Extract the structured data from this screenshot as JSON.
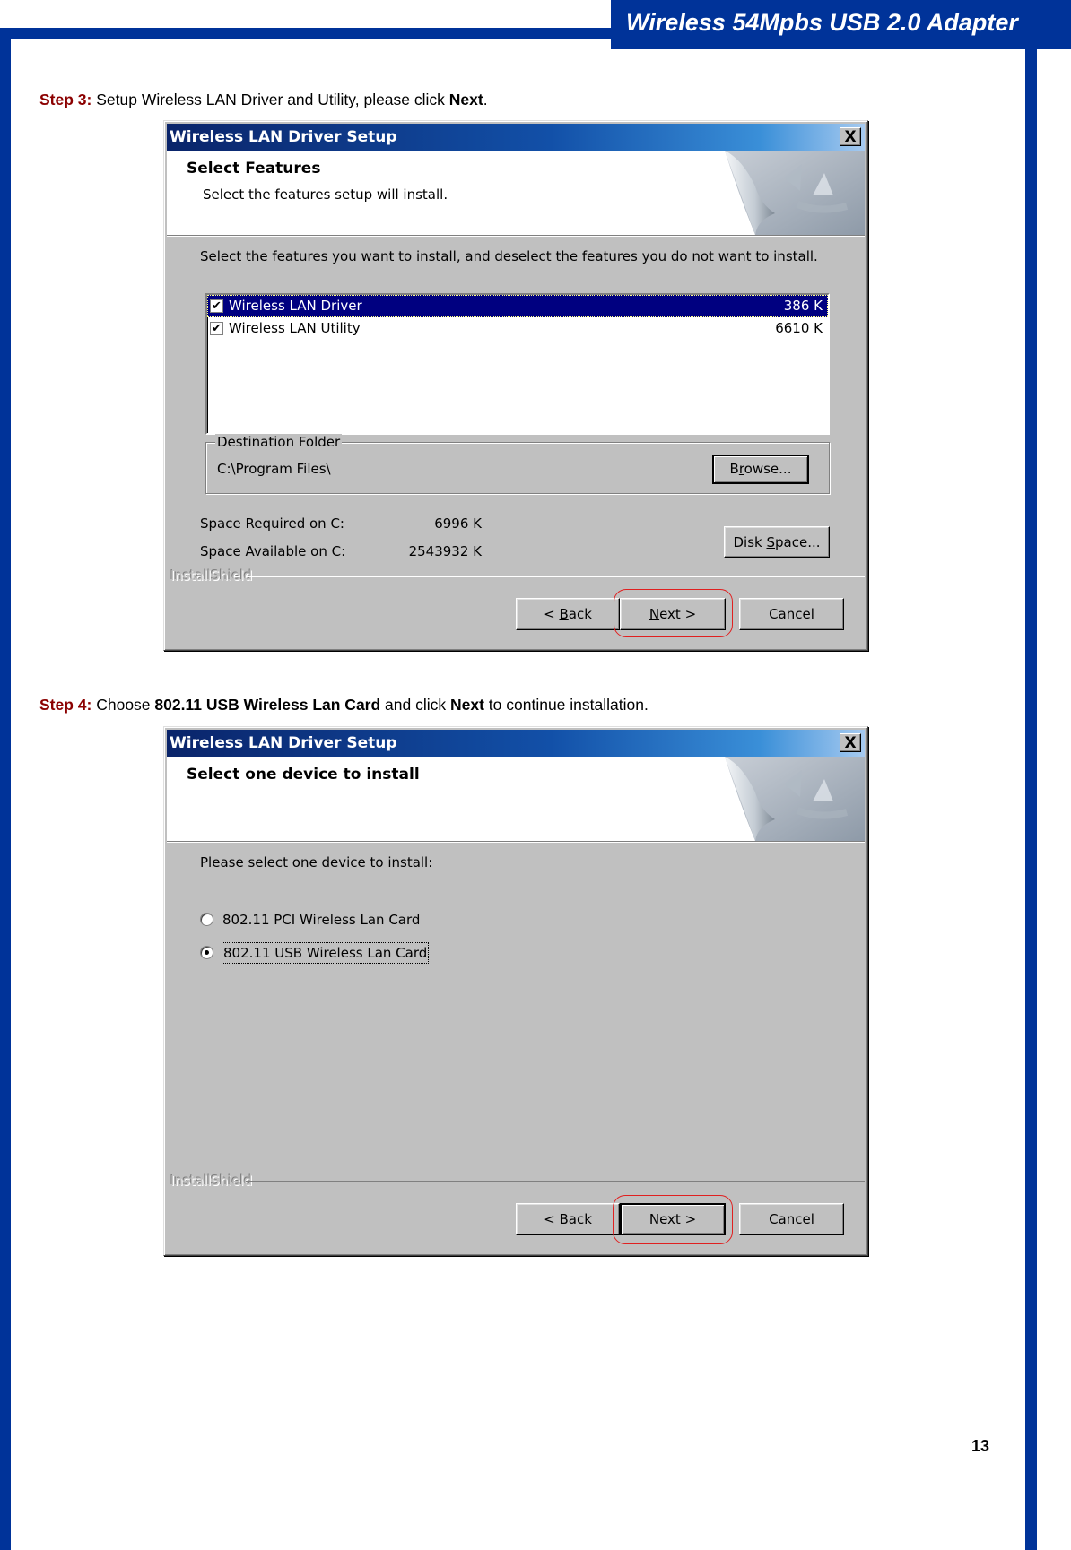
{
  "page": {
    "banner_title": "Wireless 54Mpbs USB 2.0 Adapter",
    "page_number": "13",
    "brand_color": "#003399",
    "step_label_color": "#8b0000"
  },
  "step3": {
    "label": "Step 3:",
    "text_before": " Setup Wireless LAN Driver and Utility, please click ",
    "bold": "Next",
    "text_after": "."
  },
  "step4": {
    "label": "Step 4:",
    "text_1": " Choose ",
    "bold_1": "802.11 USB Wireless Lan Card",
    "text_2": " and click ",
    "bold_2": "Next",
    "text_3": " to continue installation."
  },
  "dialog1": {
    "title": "Wireless LAN Driver Setup",
    "close_glyph": "X",
    "header_title": "Select Features",
    "header_subtitle": "Select the features setup will install.",
    "instruction": "Select the features you want to install, and deselect the features you do not want to install.",
    "features": [
      {
        "name": "Wireless LAN Driver",
        "size": "386 K",
        "checked": true,
        "selected": true
      },
      {
        "name": "Wireless LAN Utility",
        "size": "6610 K",
        "checked": true,
        "selected": false
      }
    ],
    "destination_legend": "Destination Folder",
    "destination_path": "C:\\Program Files\\",
    "browse_button": {
      "pre": "B",
      "accel": "r",
      "post": "owse..."
    },
    "space_required_label": "Space Required on C:",
    "space_required_value": "6996 K",
    "space_available_label": "Space Available on C:",
    "space_available_value": "2543932 K",
    "disk_space_button": {
      "pre": "Disk ",
      "accel": "S",
      "post": "pace..."
    },
    "installshield_label": "InstallShield",
    "back_button": {
      "pre": "< ",
      "accel": "B",
      "post": "ack"
    },
    "next_button": {
      "pre": "",
      "accel": "N",
      "post": "ext >"
    },
    "cancel_button": "Cancel",
    "highlighted_button": "next"
  },
  "dialog2": {
    "title": "Wireless LAN Driver Setup",
    "close_glyph": "X",
    "header_title": "Select one device to install",
    "instruction": "Please select one device to install:",
    "devices": [
      {
        "name": "802.11 PCI Wireless Lan Card",
        "checked": false
      },
      {
        "name": "802.11 USB Wireless Lan Card",
        "checked": true
      }
    ],
    "installshield_label": "InstallShield",
    "back_button": {
      "pre": "< ",
      "accel": "B",
      "post": "ack"
    },
    "next_button": {
      "pre": "",
      "accel": "N",
      "post": "ext >"
    },
    "cancel_button": "Cancel",
    "highlighted_button": "next"
  }
}
